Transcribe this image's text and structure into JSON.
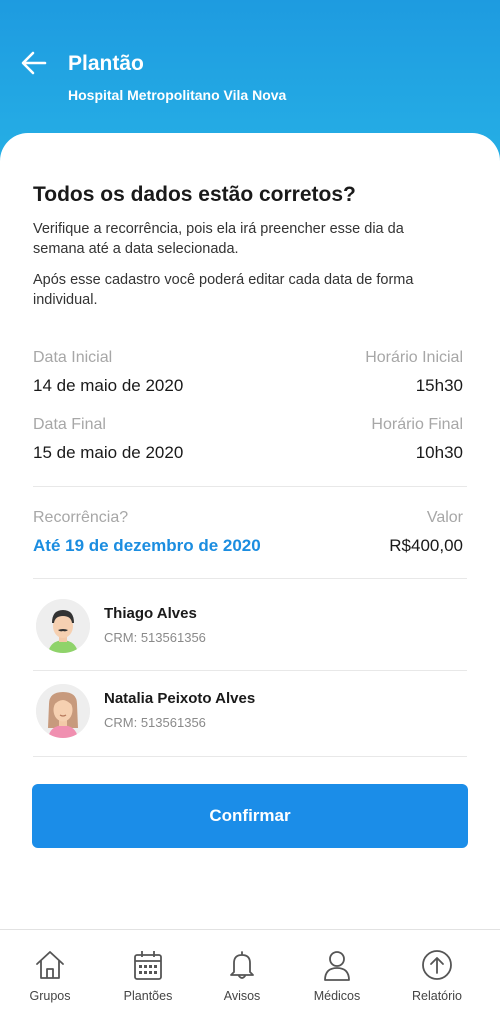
{
  "header": {
    "title": "Plantão",
    "subtitle": "Hospital Metropolitano Vila Nova"
  },
  "confirm": {
    "heading": "Todos os dados estão corretos?",
    "para1": "Verifique a recorrência, pois ela irá preencher esse dia da semana até a data selecionada.",
    "para2": "Após esse cadastro você poderá editar cada data de forma individual."
  },
  "details": {
    "start_date_label": "Data Inicial",
    "start_date": "14 de maio de 2020",
    "start_time_label": "Horário Inicial",
    "start_time": "15h30",
    "end_date_label": "Data Final",
    "end_date": "15 de maio de 2020",
    "end_time_label": "Horário Final",
    "end_time": "10h30",
    "recurrence_label": "Recorrência?",
    "recurrence": "Até 19 de dezembro de 2020",
    "value_label": "Valor",
    "value": "R$400,00"
  },
  "doctors": [
    {
      "name": "Thiago Alves",
      "crm": "CRM: 513561356"
    },
    {
      "name": "Natalia Peixoto Alves",
      "crm": "CRM: 513561356"
    }
  ],
  "confirm_button": "Confirmar",
  "nav": [
    {
      "label": "Grupos",
      "icon": "home-icon"
    },
    {
      "label": "Plantões",
      "icon": "calendar-icon"
    },
    {
      "label": "Avisos",
      "icon": "bell-icon"
    },
    {
      "label": "Médicos",
      "icon": "user-icon"
    },
    {
      "label": "Relatório",
      "icon": "arrow-up-circle-icon"
    }
  ],
  "colors": {
    "header_start": "#1e9be0",
    "header_end": "#27b2e6",
    "accent": "#1b8de8",
    "link": "#1b8de0"
  }
}
